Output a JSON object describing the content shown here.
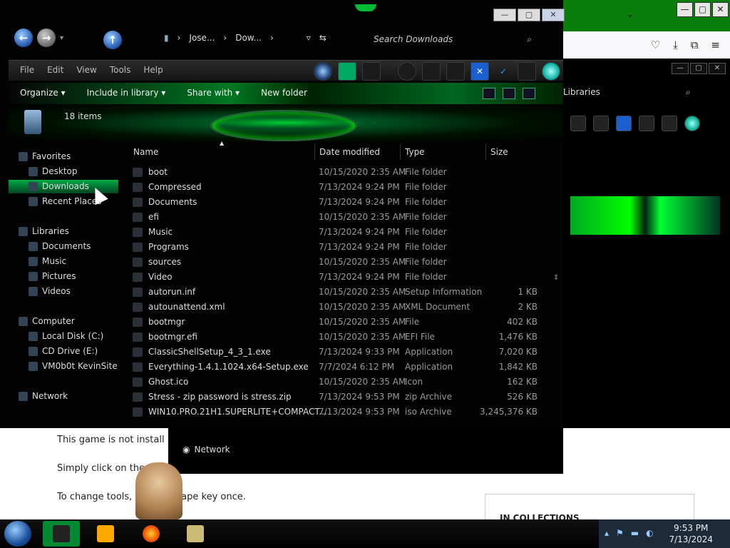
{
  "background": {
    "window_controls": [
      "—",
      "▢",
      "✕"
    ],
    "lower_text": {
      "line1": "This game is not install",
      "line2": "Simply click on the \"",
      "line3": "To change tools, pr",
      "line3b": "scape key once.",
      "collections": "IN COLLECTIONS"
    },
    "second_explorer": {
      "libraries": "Libraries",
      "network": "Network"
    }
  },
  "window": {
    "controls": {
      "minimize": "—",
      "maximize": "▢",
      "close": "✕"
    },
    "breadcrumb": [
      "Jose...",
      "Dow...",
      "▸"
    ],
    "search_placeholder": "Search Downloads",
    "menu": [
      "File",
      "Edit",
      "View",
      "Tools",
      "Help"
    ],
    "commands": {
      "organize": "Organize ▾",
      "include": "Include in library ▾",
      "share": "Share with ▾",
      "new_folder": "New folder"
    },
    "item_count": "18 items"
  },
  "sidebar": {
    "favorites": "Favorites",
    "desktop": "Desktop",
    "downloads": "Downloads",
    "recent": "Recent Places",
    "libraries": "Libraries",
    "documents": "Documents",
    "music": "Music",
    "pictures": "Pictures",
    "videos": "Videos",
    "computer": "Computer",
    "local_disk": "Local Disk (C:)",
    "cd_drive": "CD Drive (E:)",
    "vm": "VM0b0t KevinSite",
    "network": "Network"
  },
  "columns": {
    "name": "Name",
    "date": "Date modified",
    "type": "Type",
    "size": "Size"
  },
  "files": [
    {
      "name": "boot",
      "date": "10/15/2020 2:35 AM",
      "type": "File folder",
      "size": ""
    },
    {
      "name": "Compressed",
      "date": "7/13/2024 9:24 PM",
      "type": "File folder",
      "size": ""
    },
    {
      "name": "Documents",
      "date": "7/13/2024 9:24 PM",
      "type": "File folder",
      "size": ""
    },
    {
      "name": "efi",
      "date": "10/15/2020 2:35 AM",
      "type": "File folder",
      "size": ""
    },
    {
      "name": "Music",
      "date": "7/13/2024 9:24 PM",
      "type": "File folder",
      "size": ""
    },
    {
      "name": "Programs",
      "date": "7/13/2024 9:24 PM",
      "type": "File folder",
      "size": ""
    },
    {
      "name": "sources",
      "date": "10/15/2020 2:35 AM",
      "type": "File folder",
      "size": ""
    },
    {
      "name": "Video",
      "date": "7/13/2024 9:24 PM",
      "type": "File folder",
      "size": ""
    },
    {
      "name": "autorun.inf",
      "date": "10/15/2020 2:35 AM",
      "type": "Setup Information",
      "size": "1 KB"
    },
    {
      "name": "autounattend.xml",
      "date": "10/15/2020 2:35 AM",
      "type": "XML Document",
      "size": "2 KB"
    },
    {
      "name": "bootmgr",
      "date": "10/15/2020 2:35 AM",
      "type": "File",
      "size": "402 KB"
    },
    {
      "name": "bootmgr.efi",
      "date": "10/15/2020 2:35 AM",
      "type": "EFI File",
      "size": "1,476 KB"
    },
    {
      "name": "ClassicShellSetup_4_3_1.exe",
      "date": "7/13/2024 9:33 PM",
      "type": "Application",
      "size": "7,020 KB"
    },
    {
      "name": "Everything-1.4.1.1024.x64-Setup.exe",
      "date": "7/7/2024 6:12 PM",
      "type": "Application",
      "size": "1,842 KB"
    },
    {
      "name": "Ghost.ico",
      "date": "10/15/2020 2:35 AM",
      "type": "Icon",
      "size": "162 KB"
    },
    {
      "name": "Stress - zip password is stress.zip",
      "date": "7/13/2024 9:53 PM",
      "type": "zip Archive",
      "size": "526 KB"
    },
    {
      "name": "WIN10.PRO.21H1.SUPERLITE+COMPACT...",
      "date": "7/13/2024 9:53 PM",
      "type": "iso Archive",
      "size": "3,245,376 KB"
    }
  ],
  "taskbar": {
    "time": "9:53 PM",
    "date": "7/13/2024",
    "tray_arrow": "▴"
  },
  "colors": {
    "accent_green": "#0b3",
    "selection": "#0a4",
    "taskbar": "#000000"
  }
}
